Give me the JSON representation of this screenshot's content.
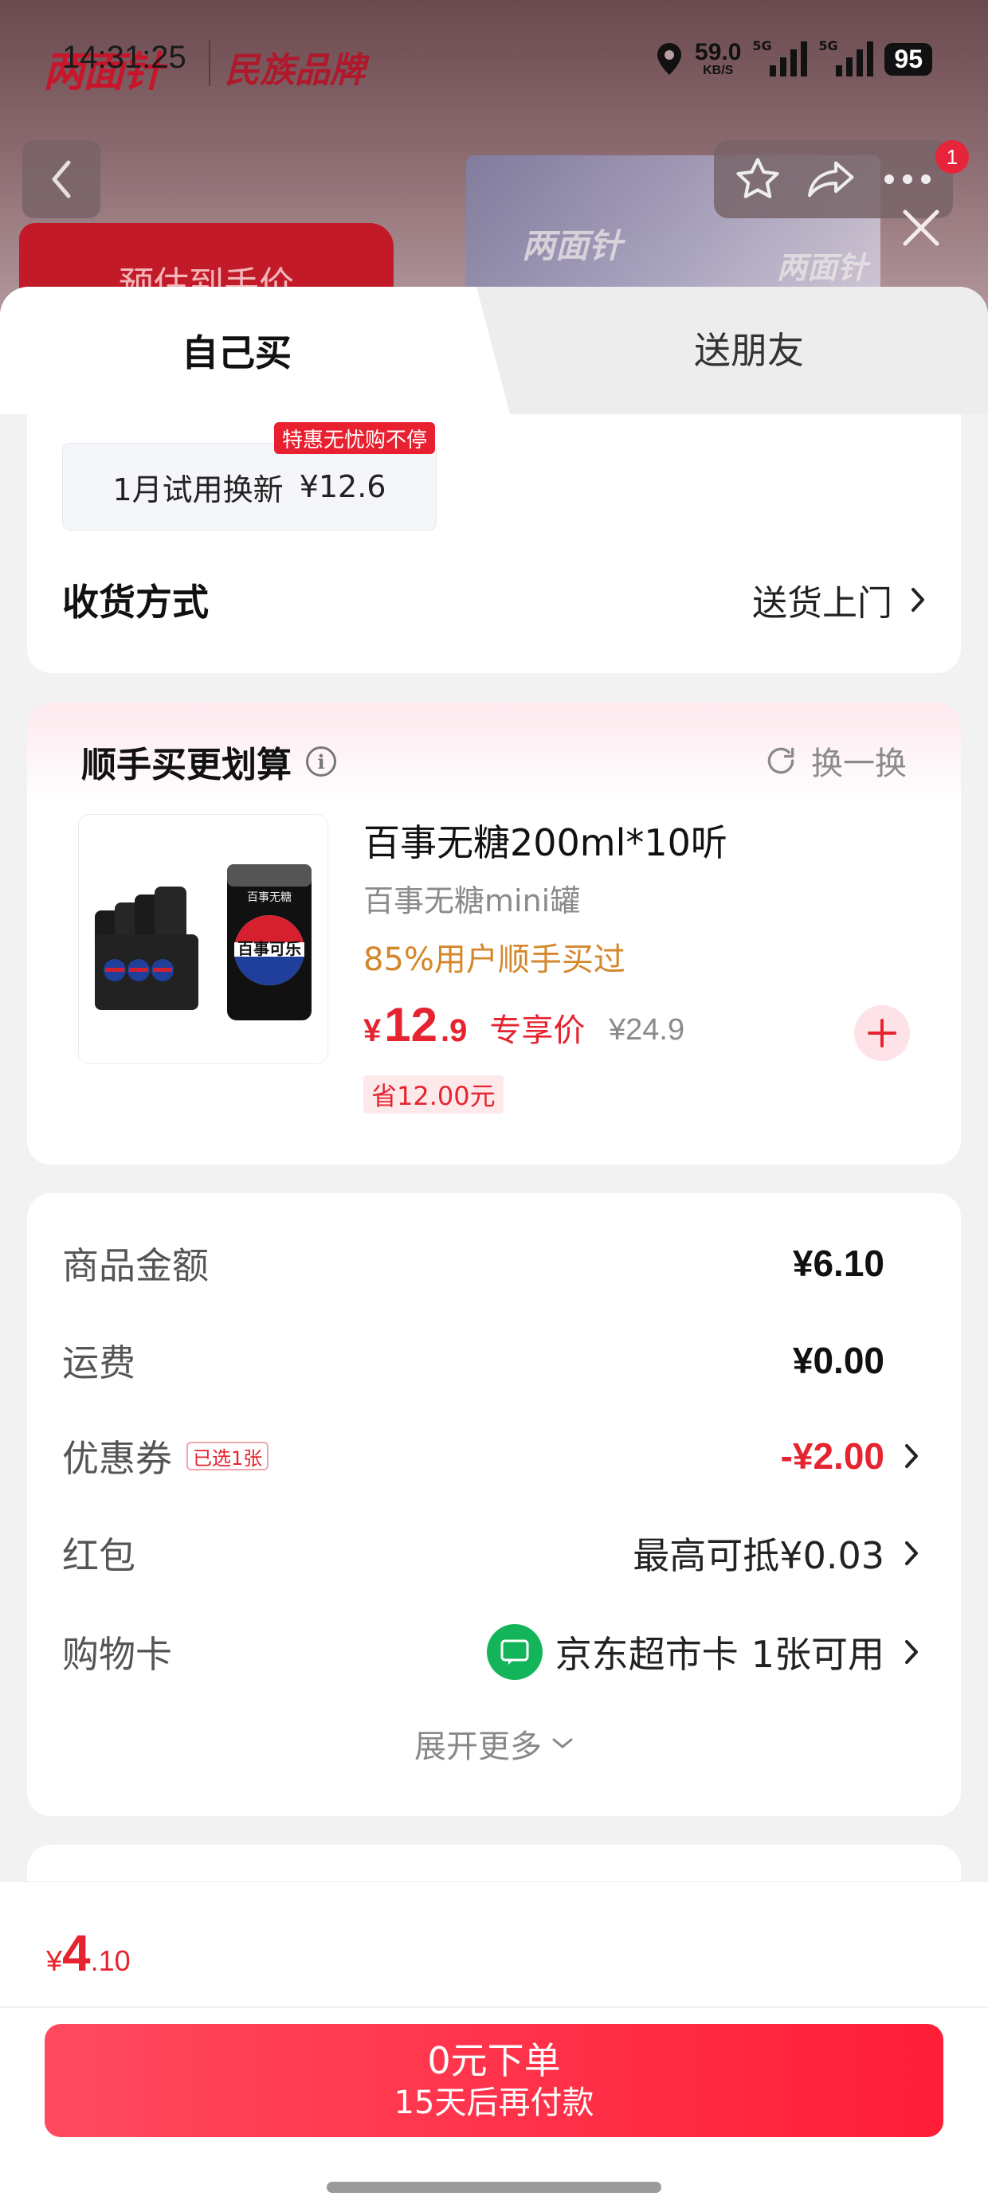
{
  "status_bar": {
    "time": "14:31:25",
    "net_speed": "59.0",
    "net_unit": "KB/S",
    "signal_1": "5G",
    "signal_2": "5G",
    "battery": "95"
  },
  "background": {
    "brand": "两面针",
    "slogan": "民族品牌",
    "presale_label": "预估到手价",
    "badge_count": "1",
    "art_text": "两面针"
  },
  "tabs": {
    "self": "自己买",
    "friend": "送朋友"
  },
  "trial": {
    "badge": "特惠无忧购不停",
    "label": "1月试用换新",
    "price": "¥12.6"
  },
  "delivery": {
    "label": "收货方式",
    "value": "送货上门"
  },
  "upsell": {
    "title": "顺手买更划算",
    "refresh": "换一换",
    "product": {
      "name": "百事无糖200ml*10听",
      "subtitle": "百事无糖mini罐",
      "hint": "85%用户顺手买过",
      "price_currency": "¥",
      "price_int": "12",
      "price_dec": ".9",
      "price_tag": "专享价",
      "original_price": "¥24.9",
      "saving": "省12.00元",
      "can_label": "百事可乐",
      "can_top": "百事无糖"
    }
  },
  "summary": {
    "goods_label": "商品金额",
    "goods_value": "¥6.10",
    "shipping_label": "运费",
    "shipping_value": "¥0.00",
    "coupon_label": "优惠券",
    "coupon_badge": "已选1张",
    "coupon_value": "-¥2.00",
    "redpacket_label": "红包",
    "redpacket_value": "最高可抵¥0.03",
    "giftcard_label": "购物卡",
    "giftcard_name": "京东超市卡",
    "giftcard_value": "1张可用",
    "expand": "展开更多"
  },
  "bottom": {
    "total_currency": "¥",
    "total_int": "4",
    "total_dec": ".10",
    "button_line1": "0元下单",
    "button_line2": "15天后再付款"
  },
  "colors": {
    "accent_red": "#e6242f",
    "button_gradient_start": "#ff4a5f",
    "button_gradient_end": "#ff1d38",
    "hint_orange": "#d4872a",
    "giftcard_green": "#14b55a"
  },
  "icons": [
    "back-icon",
    "star-icon",
    "share-icon",
    "more-icon",
    "close-icon",
    "info-icon",
    "refresh-icon",
    "plus-icon",
    "chevron-right-icon",
    "chevron-down-icon",
    "giftcard-icon",
    "location-icon"
  ]
}
